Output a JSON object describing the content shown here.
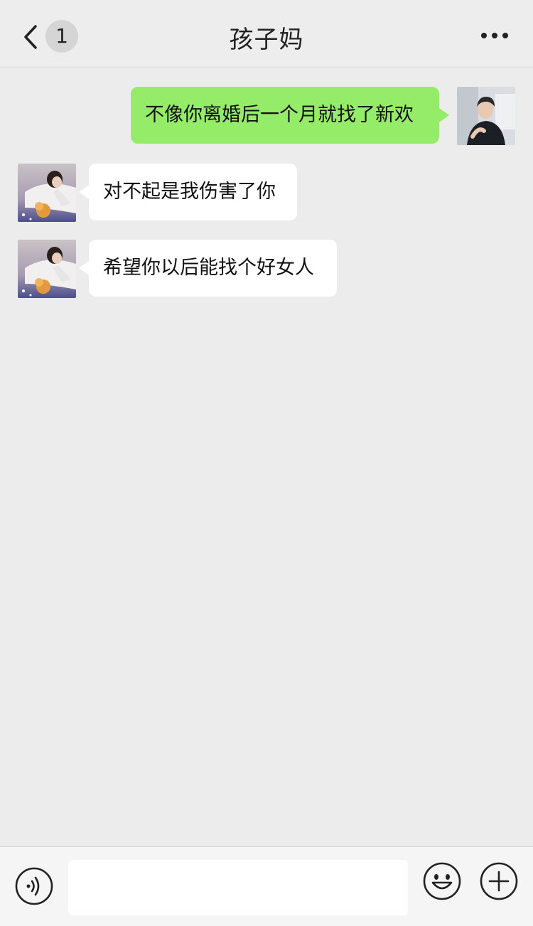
{
  "header": {
    "title": "孩子妈",
    "unread_count": "1",
    "back_icon": "chevron-left-icon",
    "more_icon": "more-dots-icon"
  },
  "messages": [
    {
      "direction": "outgoing",
      "text": "不像你离婚后一个月就找了新欢"
    },
    {
      "direction": "incoming",
      "text": "对不起是我伤害了你"
    },
    {
      "direction": "incoming",
      "text": "希望你以后能找个好女人"
    }
  ],
  "input_bar": {
    "text_value": "",
    "voice_icon": "voice-icon",
    "emoji_icon": "emoji-icon",
    "plus_icon": "plus-icon"
  },
  "colors": {
    "background": "#ececec",
    "outgoing_bubble": "#95ec69",
    "incoming_bubble": "#ffffff"
  }
}
